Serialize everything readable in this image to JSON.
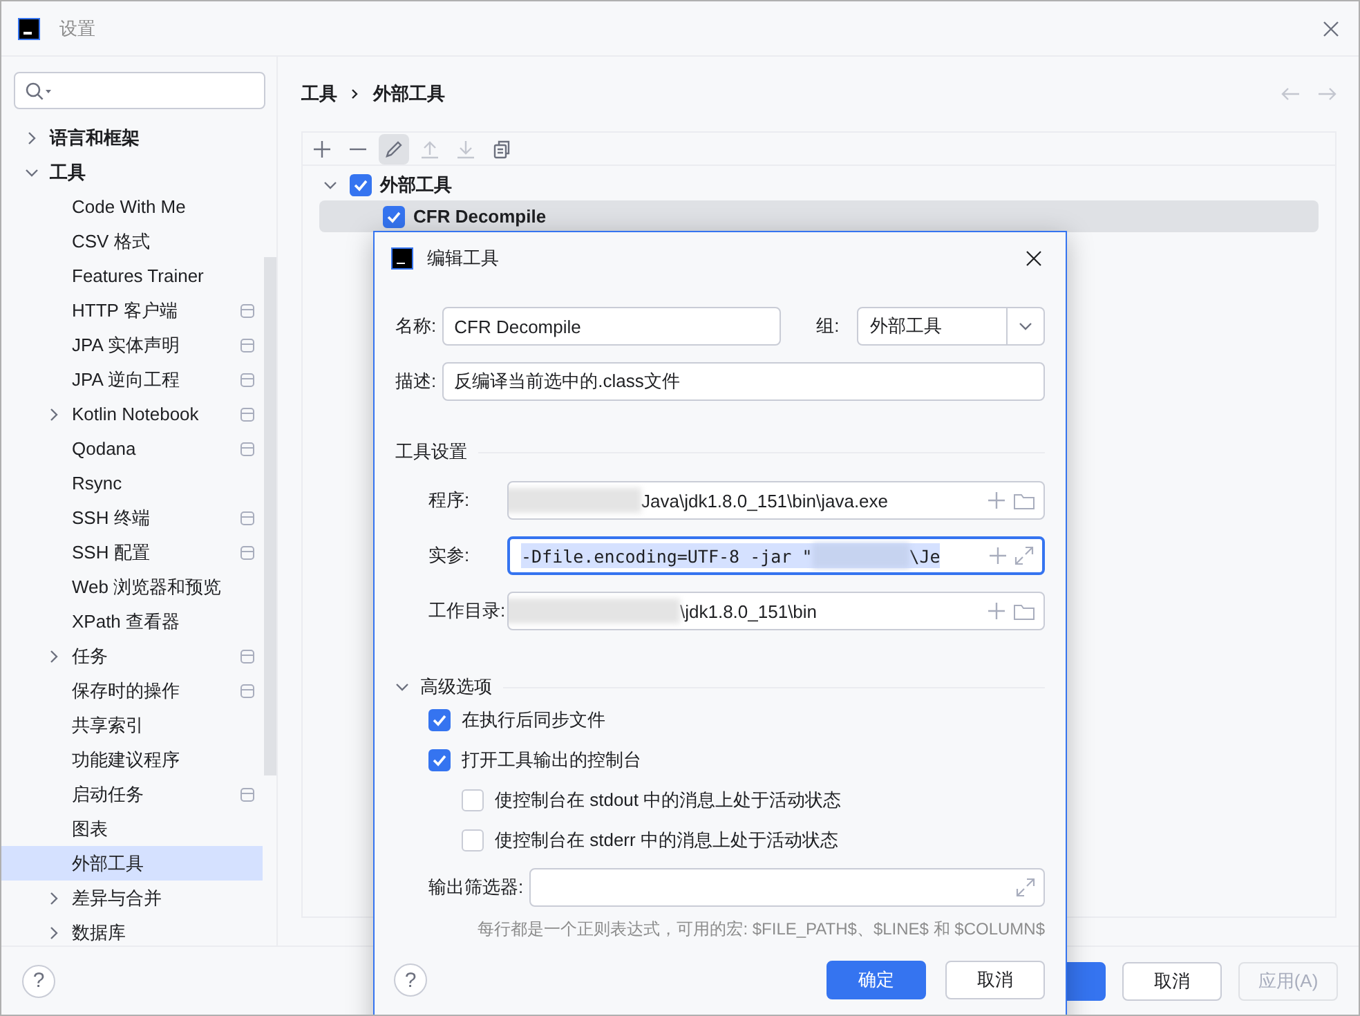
{
  "window": {
    "title": "设置"
  },
  "sidebar": {
    "items": [
      {
        "label": "语言和框架",
        "expanded": false,
        "selected": false,
        "scoped": false
      },
      {
        "label": "工具",
        "expanded": true,
        "selected": false,
        "scoped": false,
        "children": [
          {
            "label": "Code With Me",
            "selected": false,
            "scoped": false
          },
          {
            "label": "CSV 格式",
            "selected": false,
            "scoped": false
          },
          {
            "label": "Features Trainer",
            "selected": false,
            "scoped": false
          },
          {
            "label": "HTTP 客户端",
            "selected": false,
            "scoped": true
          },
          {
            "label": "JPA 实体声明",
            "selected": false,
            "scoped": true
          },
          {
            "label": "JPA 逆向工程",
            "selected": false,
            "scoped": true
          },
          {
            "label": "Kotlin Notebook",
            "expanded": false,
            "selected": false,
            "scoped": true
          },
          {
            "label": "Qodana",
            "selected": false,
            "scoped": true
          },
          {
            "label": "Rsync",
            "selected": false,
            "scoped": false
          },
          {
            "label": "SSH 终端",
            "selected": false,
            "scoped": true
          },
          {
            "label": "SSH 配置",
            "selected": false,
            "scoped": true
          },
          {
            "label": "Web 浏览器和预览",
            "selected": false,
            "scoped": false
          },
          {
            "label": "XPath 查看器",
            "selected": false,
            "scoped": false
          },
          {
            "label": "任务",
            "expanded": false,
            "selected": false,
            "scoped": true
          },
          {
            "label": "保存时的操作",
            "selected": false,
            "scoped": true
          },
          {
            "label": "共享索引",
            "selected": false,
            "scoped": false
          },
          {
            "label": "功能建议程序",
            "selected": false,
            "scoped": false
          },
          {
            "label": "启动任务",
            "selected": false,
            "scoped": true
          },
          {
            "label": "图表",
            "selected": false,
            "scoped": false
          },
          {
            "label": "外部工具",
            "selected": true,
            "scoped": false
          },
          {
            "label": "差异与合并",
            "expanded": false,
            "selected": false,
            "scoped": false
          },
          {
            "label": "数据库",
            "expanded": false,
            "selected": false,
            "scoped": false
          }
        ]
      }
    ]
  },
  "breadcrumb": [
    "工具",
    "外部工具"
  ],
  "toolbar": [
    {
      "kind": "add",
      "disabled": false,
      "pressed": false
    },
    {
      "kind": "remove",
      "disabled": false,
      "pressed": false
    },
    {
      "kind": "edit",
      "disabled": false,
      "pressed": true
    },
    {
      "kind": "up",
      "disabled": true,
      "pressed": false
    },
    {
      "kind": "down",
      "disabled": true,
      "pressed": false
    },
    {
      "kind": "copy",
      "disabled": false,
      "pressed": false
    }
  ],
  "tools": [
    {
      "label": "外部工具",
      "checked": true,
      "expanded": true,
      "selected": false,
      "children": [
        {
          "label": "CFR Decompile",
          "checked": true,
          "selected": true
        }
      ]
    }
  ],
  "help": {
    "label": "?"
  },
  "footer_buttons": [
    {
      "kind": "primary",
      "disabled": false
    },
    {
      "kind": "plain",
      "label": "取消",
      "disabled": false
    },
    {
      "kind": "plain",
      "label": "应用(A)",
      "disabled": true
    }
  ],
  "dialog": {
    "title": "编辑工具",
    "name": {
      "label": "名称:",
      "value": "CFR Decompile"
    },
    "group": {
      "label": "组:",
      "value": "外部工具"
    },
    "description": {
      "label": "描述:",
      "value": "反编译当前选中的.class文件"
    },
    "tool_settings": {
      "title": "工具设置",
      "rows": [
        {
          "kind": "path",
          "label": "程序:",
          "value_end": "Java\\jdk1.8.0_151\\bin\\java.exe",
          "focused": false
        },
        {
          "kind": "args",
          "label": "实参:",
          "value_start": "-Dfile.encoding=UTF-8 -jar \"",
          "value_end": "\\Je",
          "focused": true
        },
        {
          "kind": "path",
          "label": "工作目录:",
          "value_end": "\\jdk1.8.0_151\\bin",
          "focused": false
        }
      ]
    },
    "advanced": {
      "title": "高级选项",
      "expanded": true,
      "options": [
        {
          "label": "在执行后同步文件",
          "checked": true
        },
        {
          "label": "打开工具输出的控制台",
          "checked": true,
          "children": [
            {
              "label": "使控制台在 stdout 中的消息上处于活动状态",
              "checked": false
            },
            {
              "label": "使控制台在 stderr 中的消息上处于活动状态",
              "checked": false
            }
          ]
        }
      ],
      "filter": {
        "label": "输出筛选器:"
      },
      "hint": "每行都是一个正则表达式，可用的宏: $FILE_PATH$、$LINE$ 和 $COLUMN$"
    },
    "help": {
      "label": "?"
    },
    "buttons": [
      {
        "kind": "primary",
        "label": "确定"
      },
      {
        "kind": "plain",
        "label": "取消"
      }
    ]
  }
}
